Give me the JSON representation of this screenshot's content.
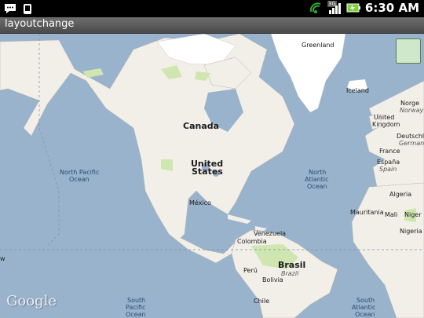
{
  "status": {
    "time": "6:30 AM",
    "network": "3G",
    "icons": [
      "message-icon",
      "android-debug-icon",
      "wifi-icon",
      "3g-signal-icon",
      "battery-icon"
    ]
  },
  "app": {
    "title": "layoutchange"
  },
  "map": {
    "provider": "Google",
    "labels": {
      "greenland": "Greenland",
      "iceland": "Iceland",
      "norge": "Norge",
      "norway": "Norway",
      "united_kingdom_1": "United",
      "united_kingdom_2": "Kingdom",
      "germany_de": "Deutschl",
      "germany": "Germany",
      "france": "France",
      "espana": "España",
      "spain": "Spain",
      "canada": "Canada",
      "usa_1": "United",
      "usa_2": "States",
      "mexico": "México",
      "north_pacific_1": "North Pacific",
      "north_pacific_2": "Ocean",
      "north_atlantic_1": "North",
      "north_atlantic_2": "Atlantic",
      "north_atlantic_3": "Ocean",
      "algeria": "Algeria",
      "mauritania": "Mauritania",
      "mali": "Mali",
      "niger": "Niger",
      "nigeria": "Nigeria",
      "venezuela": "Venezuela",
      "colombia": "Colombia",
      "peru": "Perú",
      "brasil": "Brasil",
      "brazil": "Brazil",
      "bolivia": "Bolivia",
      "chile": "Chile",
      "south_pacific_1": "South",
      "south_pacific_2": "Pacific",
      "south_pacific_3": "Ocean",
      "south_atlantic_1": "South",
      "south_atlantic_2": "Atlantic",
      "south_atlantic_3": "Ocean",
      "left_edge": "w"
    }
  },
  "colors": {
    "ocean": "#99b3cc",
    "land": "#f2efe9",
    "forest": "#cfe6b0",
    "ice": "#ffffff"
  }
}
